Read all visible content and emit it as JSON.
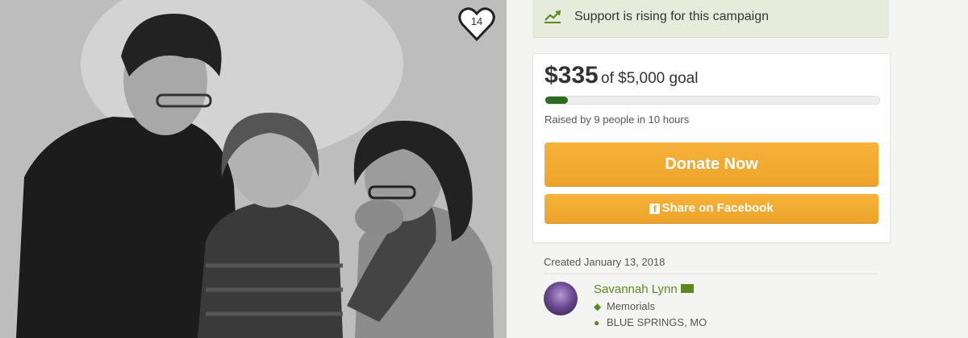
{
  "photo": {
    "likes_count": "14"
  },
  "campaign": {
    "rising_text": "Support is rising for this campaign",
    "amount_raised": "$335",
    "goal_text": "of $5,000 goal",
    "progress_fraction": 0.067,
    "raised_by": "Raised by 9 people in 10 hours"
  },
  "actions": {
    "donate_label": "Donate Now",
    "facebook_icon": "f",
    "facebook_label": "Share on Facebook"
  },
  "meta": {
    "created": "Created January 13, 2018"
  },
  "organizer": {
    "name": "Savannah Lynn",
    "category": "Memorials",
    "location": "BLUE SPRINGS, MO"
  },
  "colors": {
    "accent_orange": "#eda42a",
    "progress_green": "#2e6b1f",
    "link_green": "#5a8a1f"
  }
}
